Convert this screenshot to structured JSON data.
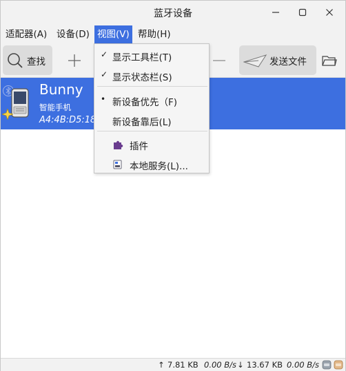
{
  "window": {
    "title": "蓝牙设备"
  },
  "menubar": {
    "items": [
      "适配器(A)",
      "设备(D)",
      "视图(V)",
      "帮助(H)"
    ]
  },
  "toolbar": {
    "search_label": "查找",
    "send_label": "发送文件"
  },
  "device": {
    "name": "Bunny",
    "type": "智能手机",
    "address": "A4:4B:D5:18"
  },
  "view_menu": {
    "items": [
      {
        "label": "显示工具栏(T)",
        "marker": "✓"
      },
      {
        "label": "显示状态栏(S)",
        "marker": "✓"
      },
      {
        "label": "新设备优先（F)",
        "marker": "•"
      },
      {
        "label": "新设备靠后(L)",
        "marker": ""
      },
      {
        "label": "插件",
        "icon": "puzzle-icon"
      },
      {
        "label": "本地服务(L)...",
        "icon": "services-icon"
      }
    ]
  },
  "statusbar": {
    "up_arrow": "↑",
    "up_total": "7.81 KB",
    "up_rate": "0.00 B/s",
    "down_arrow": "↓",
    "down_total": "13.67 KB",
    "down_rate": "0.00 B/s"
  },
  "colors": {
    "accent": "#3d6fe0",
    "chrome": "#f2f2f2"
  }
}
